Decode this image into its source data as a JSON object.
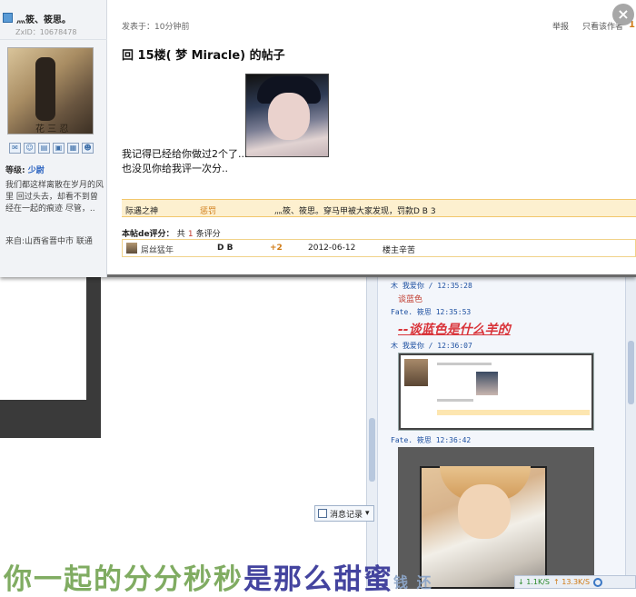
{
  "user": {
    "name": "灬筱、筱思。",
    "zxid": "ZxID：10678478",
    "avatar_caption": "花 三 忍",
    "level_label": "等级:",
    "level_value": "少尉",
    "bio": "我们都这样离散在岁月的风里 回过头去，却看不到曾经在一起的痕迹 尽管，..",
    "location": "来自:山西省晋中市 联通"
  },
  "toolbar_icons": [
    "mail-icon",
    "user-icon",
    "doc-icon",
    "photo-icon",
    "grid-icon",
    "person-icon"
  ],
  "post": {
    "posted": "发表于：10分钟前",
    "report": "举报",
    "only_author": "只看该作者",
    "floor": "1",
    "title": "回 15楼(      梦 Miracle) 的帖子",
    "body_line1": "我记得已经给你做过2个了...",
    "body_line2": "也没见你给我评一次分..",
    "close": "×"
  },
  "punish": {
    "who": "际遇之神",
    "type": "惩罚",
    "reason": "灬筱、筱思。穿马甲被大家发现，罚款D B 3"
  },
  "rating": {
    "label": "本帖de评分：",
    "prefix": "共",
    "count": "1",
    "suffix": "条评分",
    "rows": [
      {
        "user": "屌丝猛年",
        "currency": "D B",
        "amount": "+2",
        "date": "2012-06-12",
        "comment": "楼主辛苦"
      }
    ]
  },
  "chat": {
    "m1_head": "木        我爱你 / 12:35:28",
    "m1_text": "谈蓝色",
    "m2_head": "Fate.   筱思 12:35:53",
    "m2_text": "--谈蓝色是什么羊的",
    "m3_head": "木        我爱你 / 12:36:07",
    "m4_head": "Fate.   筱思 12:36:42"
  },
  "msg_record": "消息记录",
  "caption": {
    "part1": "你一起的分分秒秒",
    "part2": "是那么甜蜜",
    "part3": "钱 还"
  },
  "statusbar": {
    "down": "↓ 1.1K/S",
    "up": "↑ 13.3K/S"
  }
}
